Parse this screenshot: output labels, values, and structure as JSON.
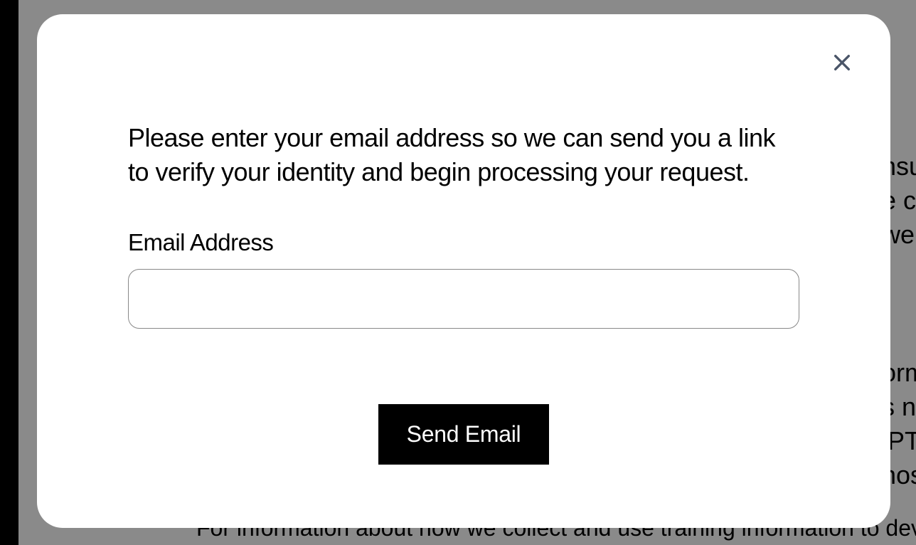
{
  "backdrop": {
    "line1": "nsu",
    "line2": "e ca",
    "line3": "we ",
    "line4": "orm",
    "line5": "s ne",
    "line6": "iPT",
    "line7": "hos",
    "footer": "For information about how we collect and use training information to deve"
  },
  "modal": {
    "prompt": "Please enter your email address so we can send you a link to verify your identity and begin processing your request.",
    "email_label": "Email Address",
    "email_value": "",
    "send_button_label": "Send Email"
  }
}
